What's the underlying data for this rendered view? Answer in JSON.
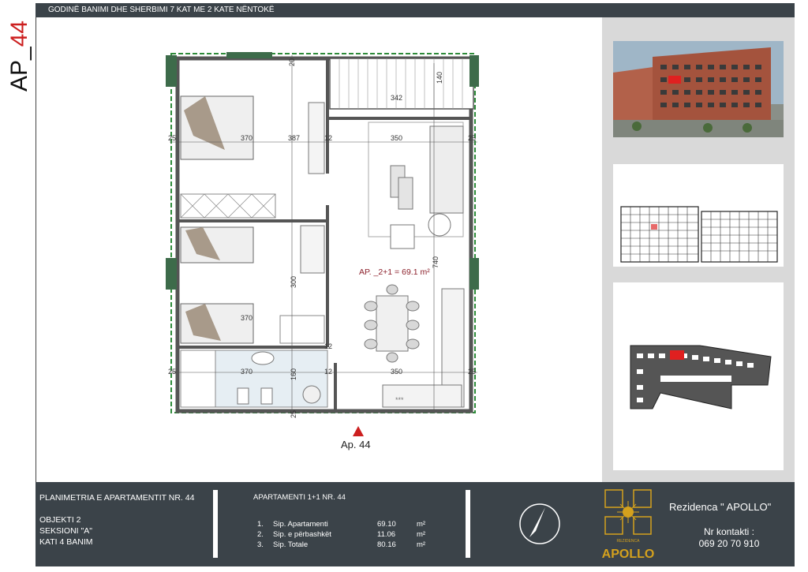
{
  "header": {
    "title": "GODINË BANIMI DHE SHERBIMI 7 KAT ME 2 KATE NËNTOKË"
  },
  "side_label": {
    "prefix": "AP_",
    "number": "44"
  },
  "floor_plan": {
    "area_label": "AP. _2+1 = 69.1 m²",
    "dimensions": [
      "370",
      "387",
      "342",
      "140",
      "20",
      "350",
      "25",
      "12",
      "300",
      "740",
      "370",
      "370",
      "160",
      "12",
      "350",
      "25",
      "25",
      "25",
      "25",
      "12"
    ],
    "hatch_label": "***"
  },
  "marker": {
    "label": "Ap. 44"
  },
  "footer": {
    "plan_title": "PLANIMETRIA E APARTAMENTIT NR. 44",
    "object": "OBJEKTI 2",
    "section": "SEKSIONI \"A\"",
    "floor": "KATI  4  BANIM",
    "apartment_title": "APARTAMENTI 1+1 NR. 44",
    "rows": [
      {
        "num": "1.",
        "label": "Sip. Apartamenti",
        "value": "69.10",
        "unit": "m²"
      },
      {
        "num": "2.",
        "label": "Sip. e përbashkët",
        "value": "11.06",
        "unit": "m²"
      },
      {
        "num": "3.",
        "label": "Sip. Totale",
        "value": "80.16",
        "unit": "m²"
      }
    ],
    "brand_small": "REZIDENCA",
    "brand_big": "APOLLO",
    "residence": "Rezidenca \" APOLLO\"",
    "contact_label": "Nr kontakti :",
    "contact_number": "069 20 70 910"
  },
  "colors": {
    "bar": "#3b4349",
    "accent": "#cc1f1f",
    "panel": "#d9d9d9",
    "wall_green": "#2e8b3a"
  }
}
